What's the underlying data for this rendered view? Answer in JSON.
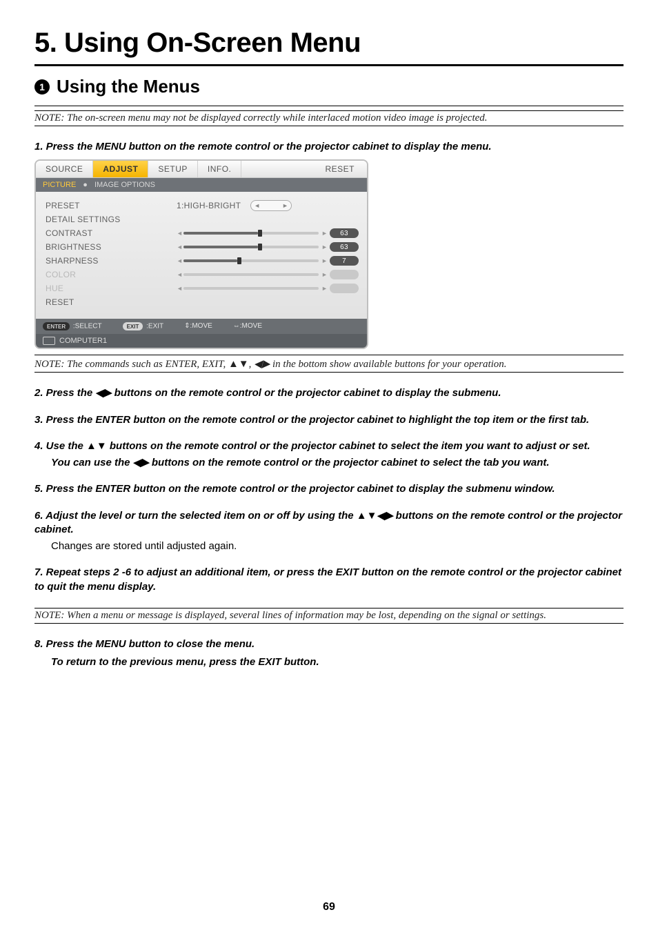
{
  "chapter": {
    "title": "5. Using On-Screen Menu"
  },
  "section": {
    "number": "1",
    "title": "Using the Menus"
  },
  "notes": {
    "n1": "NOTE: The on-screen menu may not be displayed correctly while interlaced motion video image is projected.",
    "n2": "NOTE: The commands such as ENTER, EXIT, ▲▼, ◀▶ in the bottom show available buttons for your operation.",
    "n3": "NOTE: When a menu or message is displayed, several lines of information may be lost, depending on the signal or settings."
  },
  "steps": {
    "s1": "1.  Press the MENU button on the remote control or the projector cabinet to display the menu.",
    "s2": "2.  Press the ◀▶ buttons on the remote control or the projector cabinet to display the submenu.",
    "s3": "3.  Press the ENTER button on the remote control or the projector cabinet to highlight the top item or the first tab.",
    "s4": "4.  Use the ▲▼ buttons on the remote control or the projector cabinet to select the item you want to adjust or set.",
    "s4b": "You can use the ◀▶ buttons on the remote control or the projector cabinet to select the tab you want.",
    "s5": "5.  Press the ENTER button on the remote control or the projector cabinet to display the submenu window.",
    "s6": "6.  Adjust the level or turn the selected item on or off by using the ▲▼◀▶ buttons on the remote control or the projector cabinet.",
    "s6b": "Changes are stored until adjusted again.",
    "s7": "7.  Repeat steps 2 -6 to adjust an additional item, or press the EXIT button on the remote control or the projector cabinet to quit the menu display.",
    "s8a": "8.  Press the MENU button to close the menu.",
    "s8b": "To return to the previous menu, press the EXIT button."
  },
  "osd": {
    "tabs": {
      "source": "SOURCE",
      "adjust": "ADJUST",
      "setup": "SETUP",
      "info": "INFO.",
      "reset": "RESET"
    },
    "subtabs": {
      "picture": "PICTURE",
      "imageoptions": "IMAGE OPTIONS",
      "bullet": "●"
    },
    "items": {
      "preset": "PRESET",
      "preset_value": "1:HIGH-BRIGHT",
      "detail": "DETAIL SETTINGS",
      "contrast": "CONTRAST",
      "brightness": "BRIGHTNESS",
      "sharpness": "SHARPNESS",
      "color": "COLOR",
      "hue": "HUE",
      "reset": "RESET"
    },
    "values": {
      "contrast": "63",
      "brightness": "63",
      "sharpness": "7"
    },
    "footer": {
      "enter_pill": "ENTER",
      "select": ":SELECT",
      "exit_pill": "EXIT",
      "exit": ":EXIT",
      "move1": "⇕:MOVE",
      "move2": "⇔:MOVE"
    },
    "source": "COMPUTER1",
    "lr": {
      "left": "◄",
      "right": "►"
    }
  },
  "pageNumber": "69"
}
